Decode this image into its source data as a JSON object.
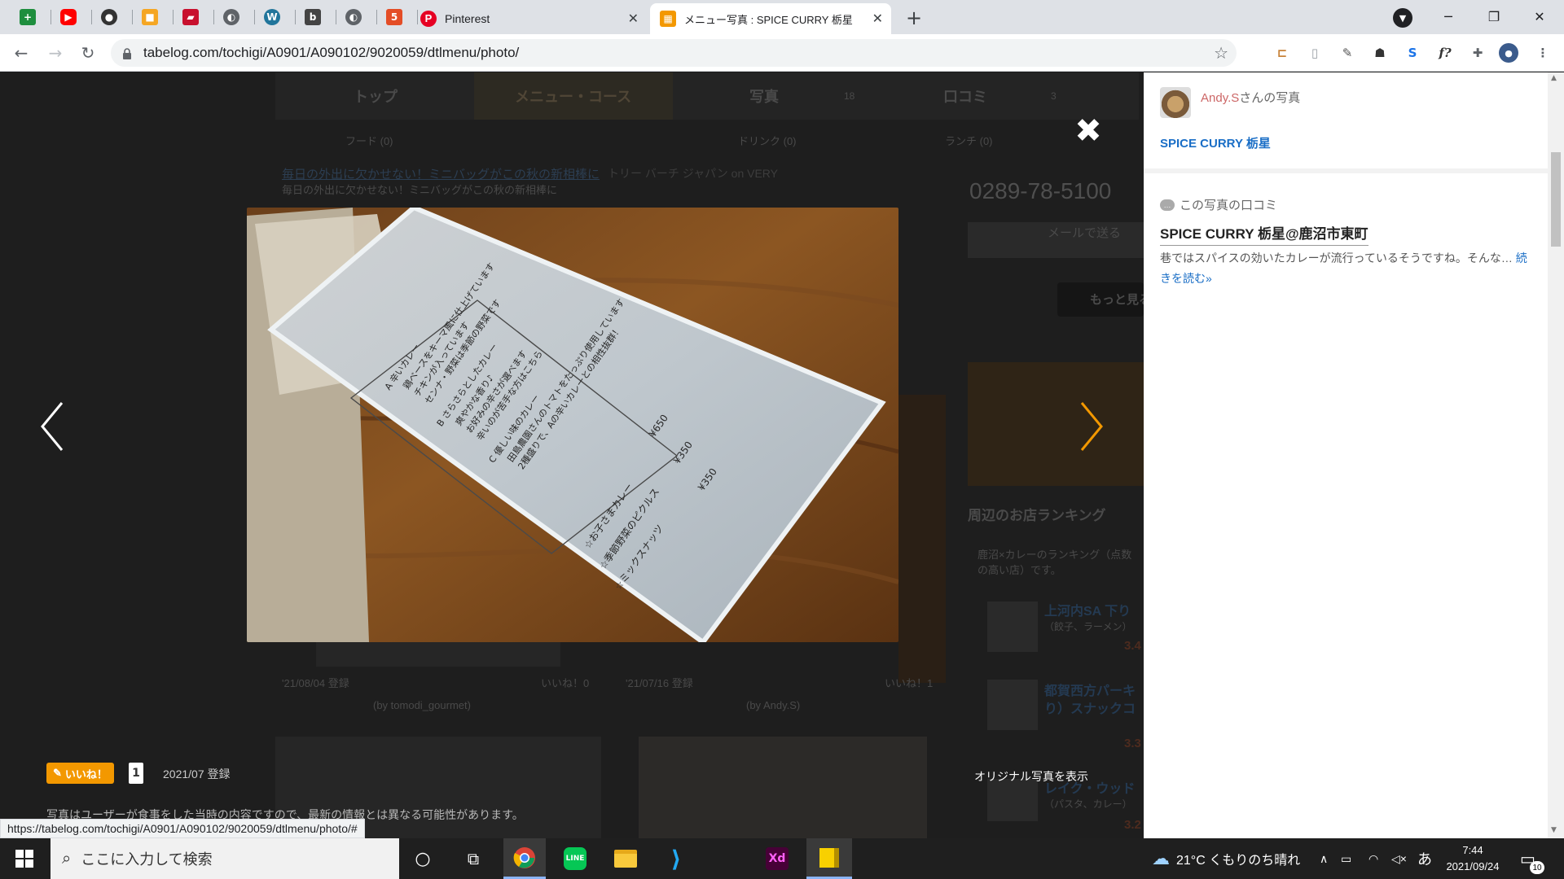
{
  "browser": {
    "tabs": [
      {
        "label": "Pinterest",
        "icon": "pinterest-icon"
      },
      {
        "label": "メニュー写真 : SPICE CURRY 栃星 -",
        "icon": "tabelog-icon",
        "active": true
      }
    ],
    "url": "tabelog.com/tochigi/A0901/A090102/9020059/dtlmenu/photo/",
    "status_url": "https://tabelog.com/tochigi/A0901/A090102/9020059/dtlmenu/photo/#"
  },
  "background_page": {
    "nav_tabs": [
      "トップ",
      "メニュー・コース",
      "写真",
      "口コミ"
    ],
    "nav_counts": [
      "18",
      "3"
    ],
    "sub_tabs": [
      "フード (0)",
      "ドリンク (0)",
      "ランチ (0)"
    ],
    "sponsor_line": "毎日の外出に欠かせない！ミニバッグがこの秋の新相棒に",
    "sponsor_source": "トリー バーチ ジャパン on VERY",
    "sponsor_line2": "毎日の外出に欠かせない！ミニバッグがこの秋の新相棒に",
    "phone": "0289-78-5100",
    "mail_text": "メールで送る",
    "more_button": "もっと見る",
    "ranking_title": "周辺のお店ランキング",
    "ranking_desc": "鹿沼×カレーのランキング（点数の高い店）です。",
    "ranking_items": [
      {
        "name": "上河内SA 下り",
        "sub": "（餃子、ラーメン）",
        "score": "3.4"
      },
      {
        "name": "都賀西方パーキ",
        "sub": "り）スナックコ",
        "score": "3.3"
      },
      {
        "name": "レイク・ウッド",
        "sub": "（パスタ、カレー）",
        "score": "3.2"
      }
    ],
    "photo_dates": [
      "'21/08/04 登録",
      "'21/07/16 登録"
    ],
    "photo_likes": [
      "いいね！0",
      "いいね！1"
    ],
    "photo_by": [
      "(by tomodi_gourmet)",
      "(by Andy.S)"
    ]
  },
  "viewer": {
    "like_label": "いいね！",
    "like_count": "1",
    "registered": "2021/07 登録",
    "original_link": "オリジナル写真を表示",
    "disclaimer": "写真はユーザーが食事をした当時の内容ですので、最新の情報とは異なる可能性があります。",
    "menu_card": {
      "items": [
        "A 辛いカレー",
        "鶏ベースをキーマ風に仕上げています",
        "チキンが入っています",
        "センナ・野菜は季節の野菜です",
        "B さらさらとしたカレー",
        "爽やかな香り♪",
        "お好みの辛さが選べます",
        "辛いのが苦手な方はこちら",
        "C 優しい味のカレー",
        "田島農園さんのトマトをたっぷり使用しています",
        "2種盛りで、Aの辛いカレーとの相性抜群！",
        "☆お子さまカレー",
        "☆季節野菜のピクルス",
        "☆ミックスナッツ"
      ],
      "prices": [
        "¥650",
        "¥350",
        "¥350"
      ]
    }
  },
  "side_panel": {
    "user_name": "Andy.S",
    "user_suffix": "さんの写真",
    "shop_name": "SPICE CURRY 栃星",
    "review_header": "この写真の口コミ",
    "review_title": "SPICE CURRY 栃星@鹿沼市東町",
    "review_body": "巷ではスパイスの効いたカレーが流行っているそうですね。そんな…",
    "read_more": "続きを読む»"
  },
  "taskbar": {
    "search_placeholder": "ここに入力して検索",
    "weather": "21°C くもりのち晴れ",
    "time": "7:44",
    "date": "2021/09/24",
    "notifications": "10",
    "ime": "あ"
  },
  "colors": {
    "accent_link": "#1a6ec6",
    "user_link": "#cc6666",
    "like_orange": "#f39800"
  }
}
